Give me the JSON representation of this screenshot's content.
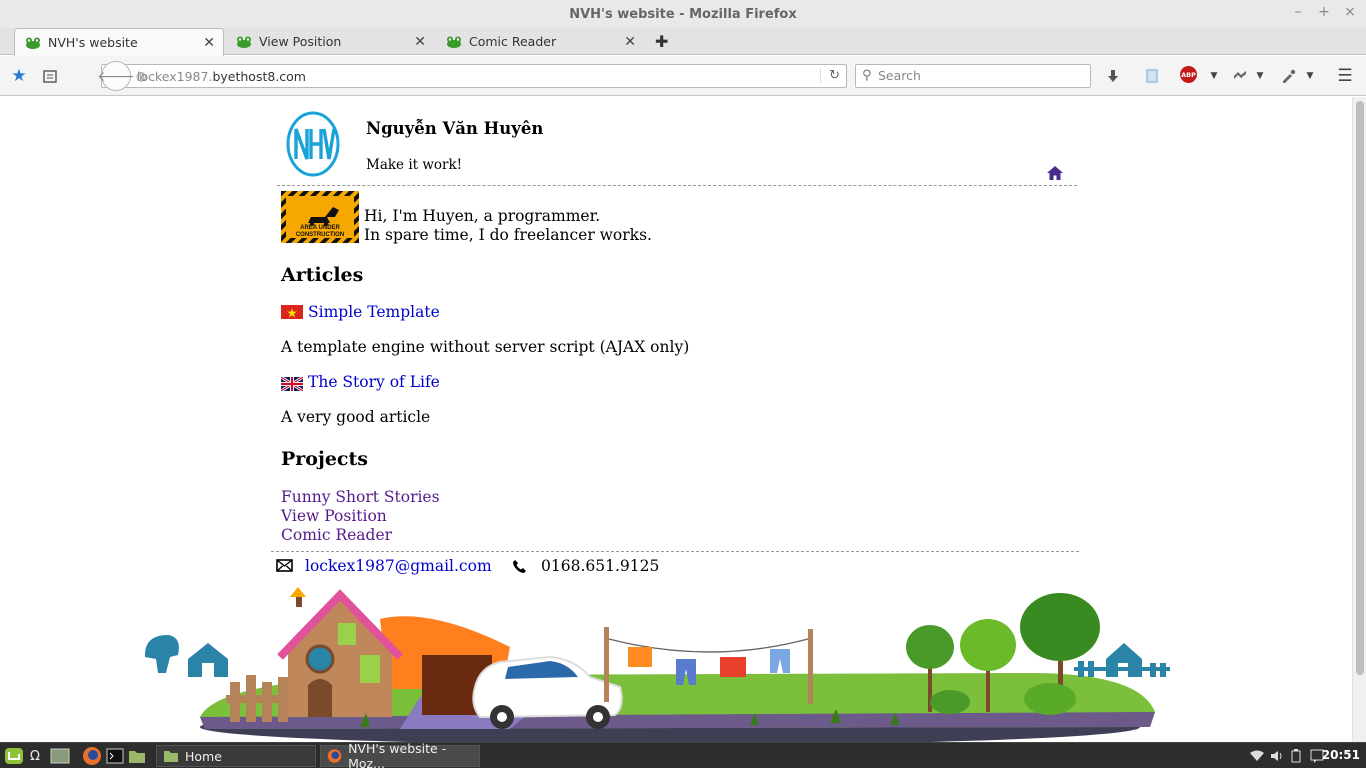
{
  "window": {
    "title": "NVH's website - Mozilla Firefox",
    "controls": [
      "–",
      "+",
      "×"
    ]
  },
  "tabs": [
    {
      "label": "NVH's website",
      "active": true
    },
    {
      "label": "View Position",
      "active": false
    },
    {
      "label": "Comic Reader",
      "active": false
    }
  ],
  "toolbar": {
    "url_plain": "lockex1987.",
    "url_host": "byethost8.com",
    "search_placeholder": "Search",
    "abp_label": "ABP"
  },
  "site": {
    "logo_text": "NHV",
    "name": "Nguyễn Văn Huyên",
    "tagline": "Make it work!",
    "construction_sign": "AREA UNDER CONSTRUCTION",
    "intro_line1": "Hi, I'm Huyen, a programmer.",
    "intro_line2": "In spare time, I do freelancer works."
  },
  "articles": {
    "heading": "Articles",
    "items": [
      {
        "title": "Simple Template",
        "flag": "vietnam-flag",
        "description": "A template engine without server script (AJAX only)"
      },
      {
        "title": "The Story of Life",
        "flag": "uk-flag",
        "description": "A very good article"
      }
    ]
  },
  "projects": {
    "heading": "Projects",
    "items": [
      "Funny Short Stories",
      "View Position",
      "Comic Reader"
    ]
  },
  "contact": {
    "email": "lockex1987@gmail.com",
    "phone": "0168.651.9125"
  },
  "taskbar": {
    "home_label": "Home",
    "window_label": "NVH's website - Moz...",
    "clock": "20:51"
  },
  "colors": {
    "link": "#0000cc",
    "visited_link": "#551a8b",
    "logo": "#1aa3d9",
    "home_icon": "#4b2a8a"
  }
}
